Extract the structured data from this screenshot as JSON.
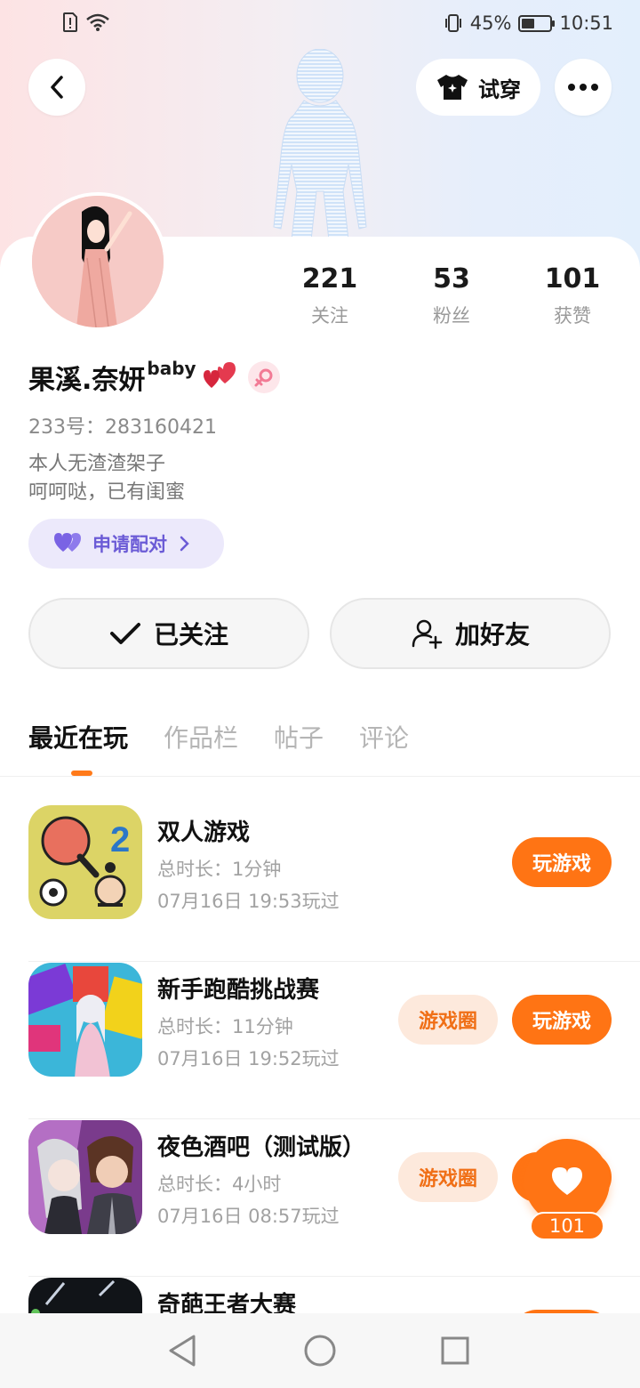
{
  "status_bar": {
    "battery_percent": "45%",
    "battery_level": 0.45,
    "time": "10:51"
  },
  "header": {
    "tryon_label": "试穿"
  },
  "profile": {
    "following_count": "221",
    "following_label": "关注",
    "fans_count": "53",
    "fans_label": "粉丝",
    "likes_count": "101",
    "likes_label": "获赞",
    "name": "果溪.奈妍",
    "name_sup": "baby",
    "id_label": "233号：",
    "id_value": "283160421",
    "bio_line1": "本人无渣渣架子",
    "bio_line2": "呵呵哒，已有闺蜜",
    "pair_label": "申请配对",
    "follow_label": "已关注",
    "add_friend_label": "加好友"
  },
  "tabs": [
    {
      "label": "最近在玩",
      "active": true
    },
    {
      "label": "作品栏",
      "active": false
    },
    {
      "label": "帖子",
      "active": false
    },
    {
      "label": "评论",
      "active": false
    }
  ],
  "games": [
    {
      "title": "双人游戏",
      "duration": "总时长：1分钟",
      "last_played": "07月16日 19:53玩过",
      "play_label": "玩游戏",
      "circle_label": ""
    },
    {
      "title": "新手跑酷挑战赛",
      "duration": "总时长：11分钟",
      "last_played": "07月16日 19:52玩过",
      "play_label": "玩游戏",
      "circle_label": "游戏圈"
    },
    {
      "title": "夜色酒吧（测试版）",
      "duration": "总时长：4小时",
      "last_played": "07月16日 08:57玩过",
      "play_label": "",
      "circle_label": "游戏圈"
    },
    {
      "title": "奇葩王者大赛",
      "duration": "",
      "last_played": "",
      "play_label": "",
      "circle_label": ""
    }
  ],
  "like_fab": {
    "count": "101"
  },
  "colors": {
    "accent": "#ff7414",
    "pair_purple": "#6b5bd6"
  }
}
